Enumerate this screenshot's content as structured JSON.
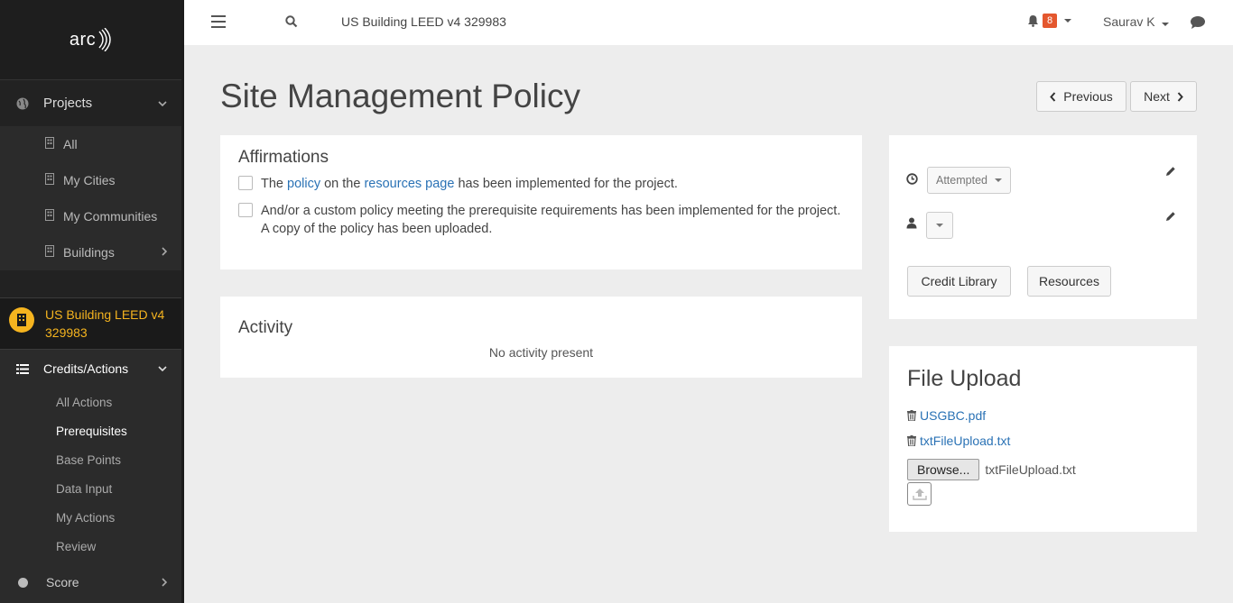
{
  "sidebar": {
    "logo": "arc",
    "projects_label": "Projects",
    "project_items": [
      {
        "label": "All"
      },
      {
        "label": "My Cities"
      },
      {
        "label": "My Communities"
      },
      {
        "label": "Buildings"
      }
    ],
    "current_project": "US Building LEED v4 329983",
    "credits_label": "Credits/Actions",
    "action_items": [
      {
        "label": "All Actions"
      },
      {
        "label": "Prerequisites"
      },
      {
        "label": "Base Points"
      },
      {
        "label": "Data Input"
      },
      {
        "label": "My Actions"
      },
      {
        "label": "Review"
      }
    ],
    "score_label": "Score"
  },
  "topbar": {
    "title": "US Building LEED v4 329983",
    "notification_count": "8",
    "user_name": "Saurav K"
  },
  "page": {
    "title": "Site Management Policy",
    "prev_label": "Previous",
    "next_label": "Next"
  },
  "affirmations": {
    "heading": "Affirmations",
    "row1": {
      "pre": "The ",
      "link1": "policy",
      "mid": " on the ",
      "link2": "resources page",
      "post": " has been implemented for the project."
    },
    "row2": "And/or a custom policy meeting the prerequisite requirements has been implemented for the project. A copy of the policy has been uploaded."
  },
  "activity": {
    "heading": "Activity",
    "empty_text": "No activity present"
  },
  "status_card": {
    "status_value": "Attempted",
    "credit_library_label": "Credit Library",
    "resources_label": "Resources"
  },
  "file_upload": {
    "heading": "File Upload",
    "files": [
      {
        "name": "USGBC.pdf"
      },
      {
        "name": "txtFileUpload.txt"
      }
    ],
    "browse_label": "Browse...",
    "selected_file": "txtFileUpload.txt"
  },
  "colors": {
    "accent": "#f5b41f",
    "link": "#2a72b5",
    "badge": "#e4572e",
    "sidebar_bg": "#2b2b2b"
  }
}
